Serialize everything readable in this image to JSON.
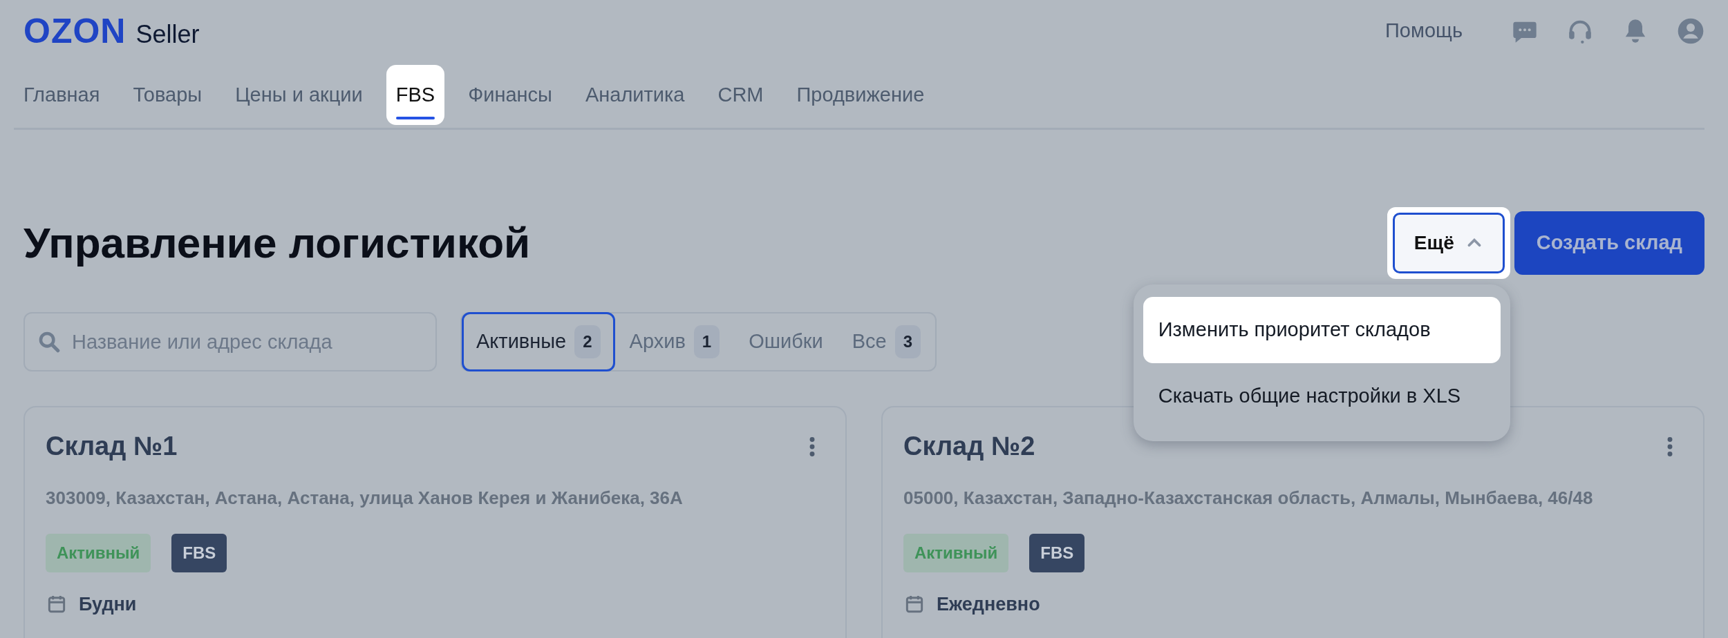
{
  "header": {
    "logo": "OZON",
    "logo_suffix": "Seller",
    "help": "Помощь"
  },
  "nav": [
    {
      "label": "Главная",
      "selected": false
    },
    {
      "label": "Товары",
      "selected": false
    },
    {
      "label": "Цены и акции",
      "selected": false
    },
    {
      "label": "FBS",
      "selected": true
    },
    {
      "label": "Финансы",
      "selected": false
    },
    {
      "label": "Аналитика",
      "selected": false
    },
    {
      "label": "CRM",
      "selected": false
    },
    {
      "label": "Продвижение",
      "selected": false
    }
  ],
  "page_title": "Управление логистикой",
  "more_button": {
    "label": "Ещё",
    "expanded": true
  },
  "create_button": "Создать склад",
  "menu": [
    {
      "label": "Изменить приоритет складов",
      "highlighted": true
    },
    {
      "label": "Скачать общие настройки в XLS",
      "highlighted": false
    }
  ],
  "search": {
    "placeholder": "Название или адрес склада"
  },
  "filters": [
    {
      "label": "Активные",
      "count": "2",
      "selected": true
    },
    {
      "label": "Архив",
      "count": "1",
      "selected": false
    },
    {
      "label": "Ошибки",
      "selected": false
    },
    {
      "label": "Все",
      "count": "3",
      "selected": false
    }
  ],
  "warehouses": [
    {
      "name": "Склад №1",
      "address": "303009, Казахстан, Астана, Астана, улица Ханов Керея и Жанибека, 36А",
      "status": "Активный",
      "type": "FBS",
      "schedule": "Будни"
    },
    {
      "name": "Склад №2",
      "address": "05000, Казахстан, Западно-Казахстанская область, Алмалы, Мынбаева, 46/48",
      "status": "Активный",
      "type": "FBS",
      "schedule": "Ежедневно"
    }
  ]
}
